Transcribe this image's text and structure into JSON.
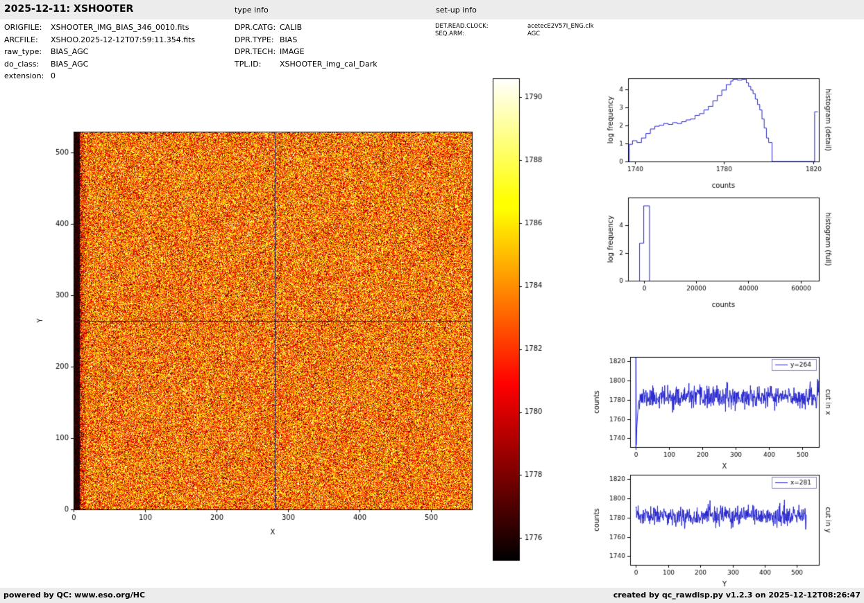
{
  "header": {
    "title": "2025-12-11: XSHOOTER",
    "type_info_label": "type info",
    "setup_info_label": "set-up info"
  },
  "metadata": {
    "col1": [
      {
        "label": "ORIGFILE:",
        "value": "XSHOOTER_IMG_BIAS_346_0010.fits"
      },
      {
        "label": "ARCFILE:",
        "value": "XSHOO.2025-12-12T07:59:11.354.fits"
      },
      {
        "label": "raw_type:",
        "value": "BIAS_AGC"
      },
      {
        "label": "do_class:",
        "value": "BIAS_AGC"
      },
      {
        "label": "extension:",
        "value": "0"
      }
    ],
    "col2": [
      {
        "label": "DPR.CATG:",
        "value": "CALIB"
      },
      {
        "label": "DPR.TYPE:",
        "value": "BIAS"
      },
      {
        "label": "DPR.TECH:",
        "value": "IMAGE"
      },
      {
        "label": "TPL.ID:",
        "value": "XSHOOTER_img_cal_Dark"
      }
    ],
    "col3": [
      {
        "label": "DET.READ.CLOCK:",
        "value": "acetecE2V57I_ENG.clk"
      },
      {
        "label": "SEQ.ARM:",
        "value": "AGC"
      }
    ]
  },
  "footer": {
    "left": "powered by QC: www.eso.org/HC",
    "right": "created by qc_rawdisp.py v1.2.3 on 2025-12-12T08:26:47"
  },
  "colors": {
    "line": "#2222cc",
    "crosshair": "#1b1b66",
    "bar_bg": "#ececec",
    "colormap": "hot"
  },
  "chart_data": [
    {
      "id": "main_image",
      "type": "heatmap",
      "xlabel": "X",
      "ylabel": "Y",
      "xlim": [
        0,
        557
      ],
      "ylim": [
        0,
        529
      ],
      "xticks": [
        0,
        100,
        200,
        300,
        400,
        500
      ],
      "yticks": [
        0,
        100,
        200,
        300,
        400,
        500
      ],
      "color_range": [
        1775.3,
        1790.6
      ],
      "noise_mean": 1783.5,
      "noise_std": 3.4,
      "seed": 7,
      "dark_column_until": 8,
      "crosshair": {
        "x": 281,
        "y": 264
      },
      "colormap": "hot"
    },
    {
      "id": "colorbar",
      "type": "colorbar",
      "range": [
        1775.3,
        1790.6
      ],
      "ticks": [
        1776,
        1778,
        1780,
        1782,
        1784,
        1786,
        1788,
        1790
      ],
      "colormap": "hot"
    },
    {
      "id": "hist_detail",
      "type": "step",
      "xlabel": "counts",
      "ylabel": "log frequency",
      "side_label": "histogram (detail)",
      "xlim": [
        1737,
        1822.5
      ],
      "ylim": [
        0,
        4.6
      ],
      "xticks": [
        1740,
        1780,
        1820
      ],
      "yticks": [
        0,
        1,
        2,
        3,
        4
      ],
      "points": [
        [
          1737.5,
          0
        ],
        [
          1737.5,
          0.95
        ],
        [
          1739,
          0.95
        ],
        [
          1739,
          1.15
        ],
        [
          1741,
          1.15
        ],
        [
          1741,
          1.05
        ],
        [
          1743,
          1.05
        ],
        [
          1743,
          1.3
        ],
        [
          1745,
          1.3
        ],
        [
          1745,
          1.55
        ],
        [
          1747,
          1.55
        ],
        [
          1747,
          1.8
        ],
        [
          1749,
          1.8
        ],
        [
          1749,
          1.95
        ],
        [
          1751,
          1.95
        ],
        [
          1751,
          2.0
        ],
        [
          1753,
          2.0
        ],
        [
          1753,
          2.1
        ],
        [
          1755,
          2.1
        ],
        [
          1755,
          2.05
        ],
        [
          1757,
          2.05
        ],
        [
          1757,
          2.15
        ],
        [
          1759,
          2.15
        ],
        [
          1759,
          2.1
        ],
        [
          1761,
          2.1
        ],
        [
          1761,
          2.2
        ],
        [
          1763,
          2.2
        ],
        [
          1763,
          2.3
        ],
        [
          1765,
          2.3
        ],
        [
          1765,
          2.35
        ],
        [
          1767,
          2.35
        ],
        [
          1767,
          2.55
        ],
        [
          1769,
          2.55
        ],
        [
          1769,
          2.65
        ],
        [
          1771,
          2.65
        ],
        [
          1771,
          2.85
        ],
        [
          1773,
          2.85
        ],
        [
          1773,
          3.05
        ],
        [
          1775,
          3.05
        ],
        [
          1775,
          3.35
        ],
        [
          1777,
          3.35
        ],
        [
          1777,
          3.65
        ],
        [
          1779,
          3.65
        ],
        [
          1779,
          3.95
        ],
        [
          1781,
          3.95
        ],
        [
          1781,
          4.25
        ],
        [
          1783,
          4.25
        ],
        [
          1783,
          4.45
        ],
        [
          1784,
          4.45
        ],
        [
          1784,
          4.55
        ],
        [
          1786,
          4.55
        ],
        [
          1786,
          4.5
        ],
        [
          1788,
          4.5
        ],
        [
          1788,
          4.55
        ],
        [
          1790,
          4.55
        ],
        [
          1790,
          4.35
        ],
        [
          1791,
          4.35
        ],
        [
          1791,
          4.15
        ],
        [
          1792,
          4.15
        ],
        [
          1792,
          3.95
        ],
        [
          1793,
          3.95
        ],
        [
          1793,
          3.75
        ],
        [
          1794,
          3.75
        ],
        [
          1794,
          3.45
        ],
        [
          1795,
          3.45
        ],
        [
          1795,
          3.15
        ],
        [
          1796,
          3.15
        ],
        [
          1796,
          2.85
        ],
        [
          1797,
          2.85
        ],
        [
          1797,
          2.35
        ],
        [
          1798,
          2.35
        ],
        [
          1798,
          1.85
        ],
        [
          1799,
          1.85
        ],
        [
          1799,
          1.3
        ],
        [
          1800,
          1.3
        ],
        [
          1800,
          1.05
        ],
        [
          1801.5,
          1.05
        ],
        [
          1801.5,
          0
        ],
        [
          1820.6,
          0
        ],
        [
          1820.6,
          2.75
        ],
        [
          1822,
          2.75
        ]
      ]
    },
    {
      "id": "hist_full",
      "type": "step",
      "xlabel": "counts",
      "ylabel": "log frequency",
      "side_label": "histogram (full)",
      "xlim": [
        -6000,
        67000
      ],
      "ylim": [
        0,
        6.0
      ],
      "xticks": [
        0,
        20000,
        40000,
        60000
      ],
      "yticks": [
        0,
        2,
        4
      ],
      "points": [
        [
          -1600,
          0
        ],
        [
          -1600,
          2.7
        ],
        [
          0,
          2.7
        ],
        [
          0,
          5.4
        ],
        [
          2200,
          5.4
        ],
        [
          2200,
          0
        ]
      ]
    },
    {
      "id": "cut_x",
      "type": "line",
      "xlabel": "X",
      "ylabel": "counts",
      "side_label": "cut in x",
      "legend": "y=264",
      "xlim": [
        -17,
        551
      ],
      "ylim": [
        1731,
        1824.5
      ],
      "xticks": [
        0,
        100,
        200,
        300,
        400,
        500
      ],
      "yticks": [
        1740,
        1760,
        1780,
        1800,
        1820
      ],
      "prefix": [
        [
          0,
          1824
        ],
        [
          0.4,
          1731
        ],
        [
          0.8,
          1825
        ],
        [
          1.5,
          1733
        ],
        [
          3,
          1750
        ],
        [
          5,
          1762
        ],
        [
          7,
          1771
        ]
      ],
      "noise": {
        "seed": 11,
        "x_start": 8,
        "x_end": 551,
        "mean": 1782.5,
        "std": 5.5
      }
    },
    {
      "id": "cut_y",
      "type": "line",
      "xlabel": "Y",
      "ylabel": "counts",
      "side_label": "cut in y",
      "legend": "x=281",
      "xlim": [
        -18,
        568
      ],
      "ylim": [
        1731,
        1824.5
      ],
      "xticks": [
        0,
        100,
        200,
        300,
        400,
        500
      ],
      "yticks": [
        1740,
        1760,
        1780,
        1800,
        1820
      ],
      "prefix": [
        [
          0,
          1790
        ]
      ],
      "noise": {
        "seed": 23,
        "x_start": 1,
        "x_end": 530,
        "mean": 1781.5,
        "std": 5.0
      }
    }
  ]
}
